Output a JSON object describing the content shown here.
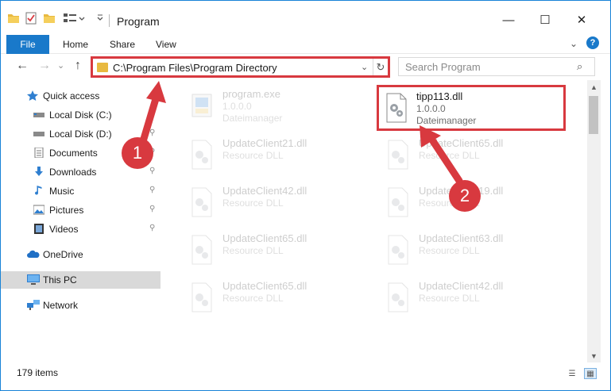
{
  "window": {
    "title": "Program",
    "controls": {
      "minimize": "—",
      "maximize": "☐",
      "close": "✕"
    }
  },
  "ribbon": {
    "tabs": [
      "File",
      "Home",
      "Share",
      "View"
    ],
    "expand": "⌄",
    "help": "?"
  },
  "nav": {
    "back": "←",
    "forward": "→",
    "recent": "⌄",
    "up": "↑",
    "address": "C:\\Program Files\\Program Directory",
    "address_dropdown": "⌄",
    "refresh": "↻",
    "search_placeholder": "Search Program",
    "search_icon": "⌕"
  },
  "sidebar": {
    "items": [
      {
        "label": "Quick access",
        "icon": "star-icon",
        "pinned": false
      },
      {
        "label": "Local Disk (C:)",
        "icon": "drive-icon",
        "pinned": true
      },
      {
        "label": "Local Disk (D:)",
        "icon": "drive-icon",
        "pinned": true
      },
      {
        "label": "Documents",
        "icon": "documents-icon",
        "pinned": true
      },
      {
        "label": "Downloads",
        "icon": "downloads-icon",
        "pinned": true
      },
      {
        "label": "Music",
        "icon": "music-icon",
        "pinned": true
      },
      {
        "label": "Pictures",
        "icon": "pictures-icon",
        "pinned": true
      },
      {
        "label": "Videos",
        "icon": "videos-icon",
        "pinned": true
      },
      {
        "label": "OneDrive",
        "icon": "onedrive-icon",
        "pinned": false
      },
      {
        "label": "This PC",
        "icon": "pc-icon",
        "pinned": false,
        "selected": true
      },
      {
        "label": "Network",
        "icon": "network-icon",
        "pinned": false
      }
    ],
    "pin_glyph": "📌"
  },
  "files": [
    {
      "name": "program.exe",
      "line2": "1.0.0.0",
      "line3": "Dateimanager",
      "faded": true,
      "type": "exe"
    },
    {
      "name": "tipp113.dll",
      "line2": "1.0.0.0",
      "line3": "Dateimanager",
      "faded": false,
      "type": "dll",
      "highlight": true
    },
    {
      "name": "UpdateClient21.dll",
      "line2": "Resource DLL",
      "line3": "",
      "faded": true,
      "type": "dll"
    },
    {
      "name": "UpdateClient65.dll",
      "line2": "Resource DLL",
      "line3": "",
      "faded": true,
      "type": "dll"
    },
    {
      "name": "UpdateClient42.dll",
      "line2": "Resource DLL",
      "line3": "",
      "faded": true,
      "type": "dll"
    },
    {
      "name": "UpdateClient19.dll",
      "line2": "Resource DLL",
      "line3": "",
      "faded": true,
      "type": "dll"
    },
    {
      "name": "UpdateClient65.dll",
      "line2": "Resource DLL",
      "line3": "",
      "faded": true,
      "type": "dll"
    },
    {
      "name": "UpdateClient63.dll",
      "line2": "Resource DLL",
      "line3": "",
      "faded": true,
      "type": "dll"
    },
    {
      "name": "UpdateClient65.dll",
      "line2": "Resource DLL",
      "line3": "",
      "faded": true,
      "type": "dll"
    },
    {
      "name": "UpdateClient42.dll",
      "line2": "Resource DLL",
      "line3": "",
      "faded": true,
      "type": "dll"
    }
  ],
  "status": {
    "items_count": "179 items"
  },
  "annotations": {
    "step1": "1",
    "step2": "2",
    "color": "#d8393f"
  }
}
